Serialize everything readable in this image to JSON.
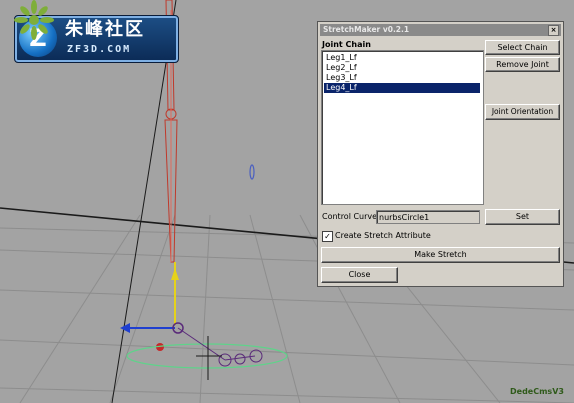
{
  "logo": {
    "badge": "Z",
    "name_cn": "朱峰社区",
    "name_en": "ZF3D.COM"
  },
  "dialog": {
    "title": "StretchMaker v0.2.1",
    "close": "×",
    "list_header": "Joint Chain",
    "joints": [
      "Leg1_Lf",
      "Leg2_Lf",
      "Leg3_Lf",
      "Leg4_Lf"
    ],
    "selected_joint": "Leg4_Lf",
    "buttons": {
      "select_chain": "Select Chain",
      "remove_joint": "Remove Joint",
      "joint_orientation": "Joint Orientation",
      "set": "Set",
      "make_stretch": "Make Stretch",
      "close": "Close"
    },
    "control_curve_label": "Control Curve:",
    "control_curve_value": "nurbsCircle1",
    "create_stretch_label": "Create Stretch Attribute",
    "create_stretch_checked": true,
    "check_mark": "✓"
  },
  "watermark": {
    "text": "DedeCmsV3"
  },
  "colors": {
    "viewport": "#a3a3a3",
    "selection": "#0a246a",
    "joint": "#c0392b"
  }
}
